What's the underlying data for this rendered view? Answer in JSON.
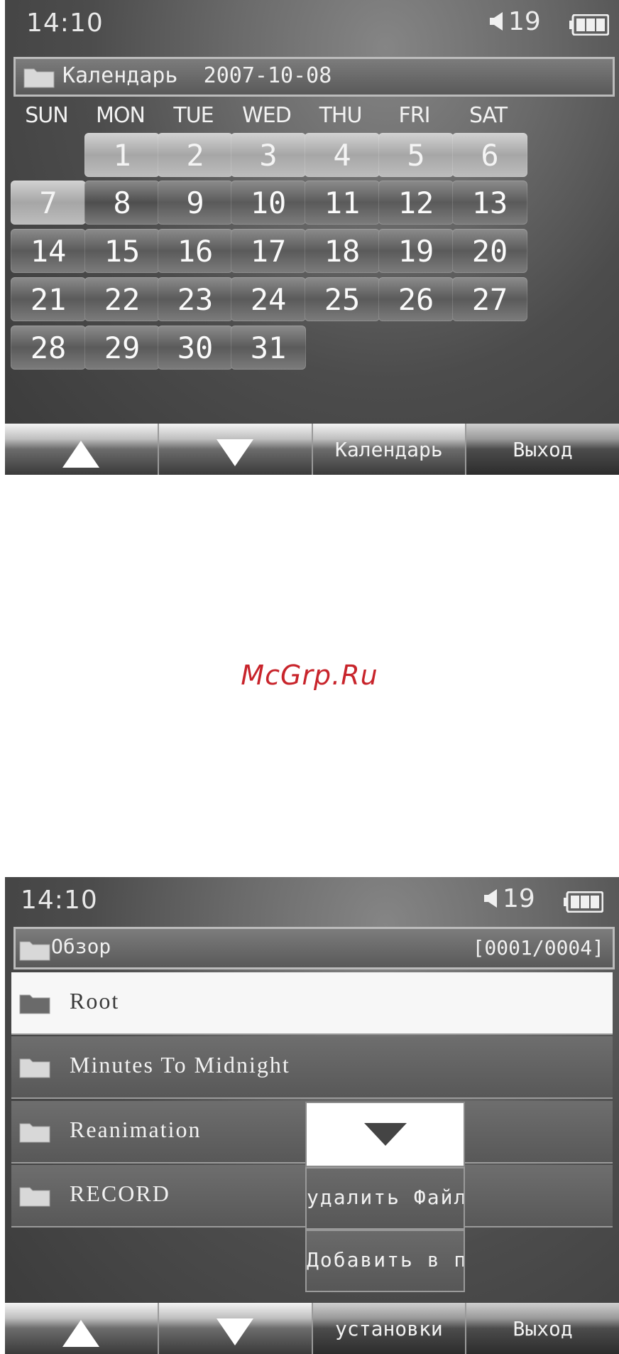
{
  "colors": {
    "watermark": "#c8242b",
    "screen_bg": "#5a5a5a",
    "selected_row": "#f7f7f7"
  },
  "screen1": {
    "status": {
      "time": "14:10",
      "volume_icon": "speaker-icon",
      "volume": "19",
      "battery_icon": "battery-icon"
    },
    "title": {
      "icon": "folder-icon",
      "text": "Календарь  2007-10-08"
    },
    "calendar": {
      "weekdays": [
        "SUN",
        "MON",
        "TUE",
        "WED",
        "THU",
        "FRI",
        "SAT"
      ],
      "days": [
        "1",
        "2",
        "3",
        "4",
        "5",
        "6",
        "7",
        "8",
        "9",
        "10",
        "11",
        "12",
        "13",
        "14",
        "15",
        "16",
        "17",
        "18",
        "19",
        "20",
        "21",
        "22",
        "23",
        "24",
        "25",
        "26",
        "27",
        "28",
        "29",
        "30",
        "31"
      ],
      "first_weekday_index": 1,
      "selected_day": "8"
    },
    "softkeys": {
      "up_icon": "triangle-up-icon",
      "down_icon": "triangle-down-icon",
      "calendar": "Календарь",
      "exit": "Выход"
    }
  },
  "watermark": "McGrp.Ru",
  "screen2": {
    "status": {
      "time": "14:10",
      "volume_icon": "speaker-icon",
      "volume": "19",
      "battery_icon": "battery-icon"
    },
    "title": {
      "icon": "folder-icon",
      "text": "Обзор",
      "counter": "[0001/0004]"
    },
    "files": [
      {
        "name": "Root",
        "selected": true
      },
      {
        "name": "Minutes To Midnight",
        "selected": false
      },
      {
        "name": "Reanimation",
        "selected": false
      },
      {
        "name": "RECORD",
        "selected": false
      }
    ],
    "popup": {
      "scroll_icon": "triangle-down-icon",
      "items": [
        "удалить Файл",
        "Добавить в плейлист"
      ]
    },
    "softkeys": {
      "up_icon": "triangle-up-icon",
      "down_icon": "triangle-down-icon",
      "settings": "установки",
      "exit": "Выход"
    }
  }
}
